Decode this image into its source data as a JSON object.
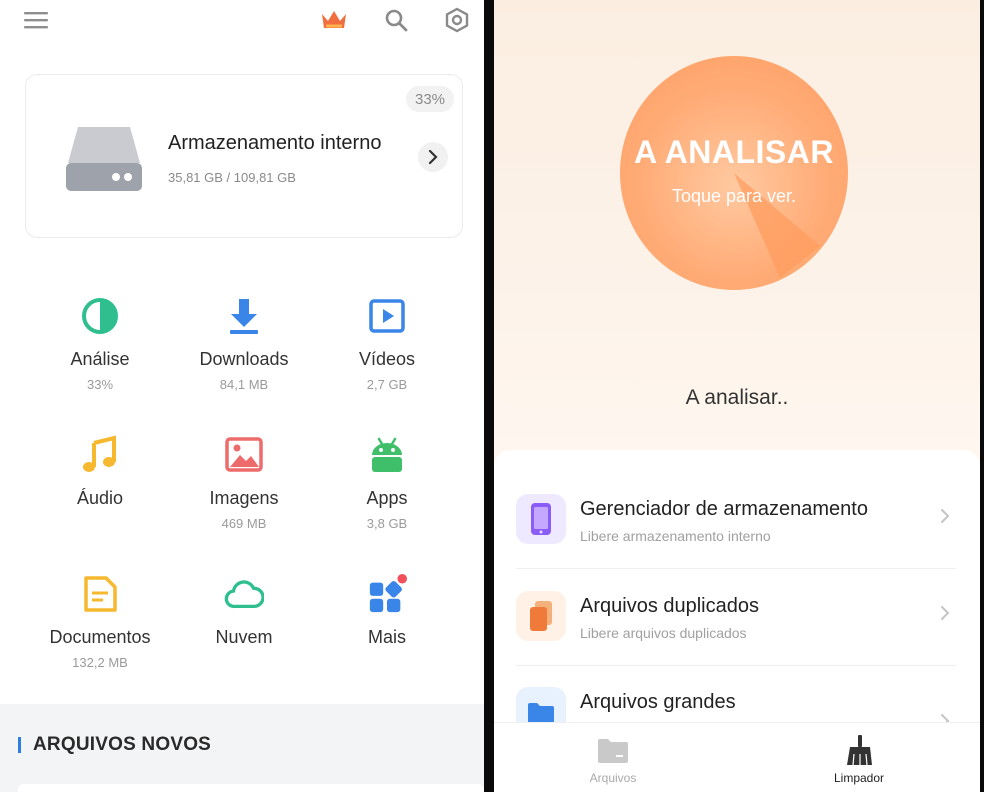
{
  "left": {
    "storage": {
      "percent": "33%",
      "title": "Armazenamento interno",
      "usage": "35,81 GB / 109,81 GB"
    },
    "categories": [
      {
        "label": "Análise",
        "value": "33%"
      },
      {
        "label": "Downloads",
        "value": "84,1 MB"
      },
      {
        "label": "Vídeos",
        "value": "2,7 GB"
      },
      {
        "label": "Áudio",
        "value": ""
      },
      {
        "label": "Imagens",
        "value": "469 MB"
      },
      {
        "label": "Apps",
        "value": "3,8 GB"
      },
      {
        "label": "Documentos",
        "value": "132,2 MB"
      },
      {
        "label": "Nuvem",
        "value": ""
      },
      {
        "label": "Mais",
        "value": ""
      }
    ],
    "section_title": "ARQUIVOS NOVOS",
    "icons": [
      "menu-icon",
      "crown-icon",
      "search-icon",
      "settings-icon",
      "drive-icon",
      "chevron-right-icon"
    ]
  },
  "right": {
    "scan": {
      "title": "A ANALISAR",
      "subtitle": "Toque para ver."
    },
    "status": "A analisar..",
    "items": [
      {
        "title": "Gerenciador de armazenamento",
        "subtitle": "Libere armazenamento interno"
      },
      {
        "title": "Arquivos duplicados",
        "subtitle": "Libere arquivos duplicados"
      },
      {
        "title": "Arquivos grandes",
        "subtitle": ""
      }
    ],
    "nav": [
      {
        "label": "Arquivos",
        "active": false
      },
      {
        "label": "Limpador",
        "active": true
      }
    ]
  },
  "colors": {
    "accent_blue": "#3a86e8",
    "analysis_green": "#2fbf8f",
    "orange_circle": "#ffab76",
    "icon_yellow": "#f5b82e",
    "icon_red": "#ee6b6b",
    "android_green": "#3fbf6a"
  }
}
